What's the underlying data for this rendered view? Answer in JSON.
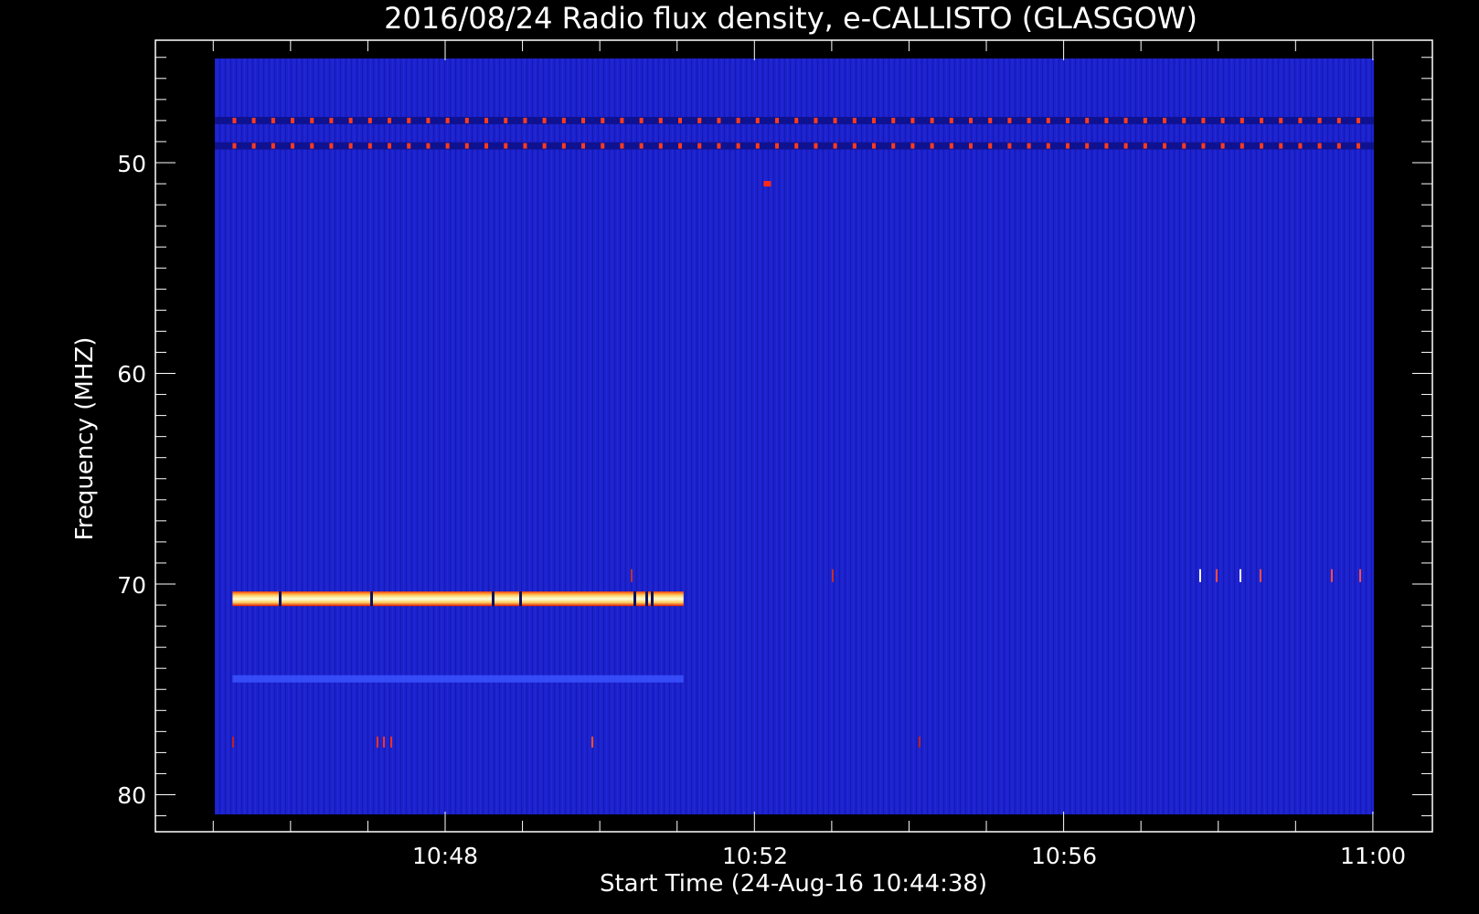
{
  "chart_data": {
    "type": "heatmap",
    "title": "2016/08/24  Radio flux density, e-CALLISTO (GLASGOW)",
    "xlabel": "Start Time (24-Aug-16 10:44:38)",
    "ylabel": "Frequency (MHZ)",
    "x_ticks": [
      "10:48",
      "10:52",
      "10:56",
      "11:00"
    ],
    "y_ticks": [
      "50",
      "60",
      "70",
      "80"
    ],
    "y_reversed": true,
    "background_color": "#1a1fc8",
    "features": [
      {
        "kind": "dotted-band",
        "freq_mhz": 48.0,
        "t_start": "10:45:15",
        "t_end": "11:00",
        "color": "#ff3b1e"
      },
      {
        "kind": "dotted-band",
        "freq_mhz": 49.2,
        "t_start": "10:45:15",
        "t_end": "11:00",
        "color": "#ff3b1e"
      },
      {
        "kind": "bright-band",
        "freq_mhz": 70.7,
        "t_start": "10:45:15",
        "t_end": "10:51:05",
        "color": "#fff8b0"
      },
      {
        "kind": "faint-band",
        "freq_mhz": 74.5,
        "t_start": "10:45:15",
        "t_end": "10:51:05",
        "color": "#3a52ff"
      },
      {
        "kind": "spot",
        "freq_mhz": 51.0,
        "time": "10:52:10",
        "color": "#ff2a1a"
      }
    ]
  }
}
